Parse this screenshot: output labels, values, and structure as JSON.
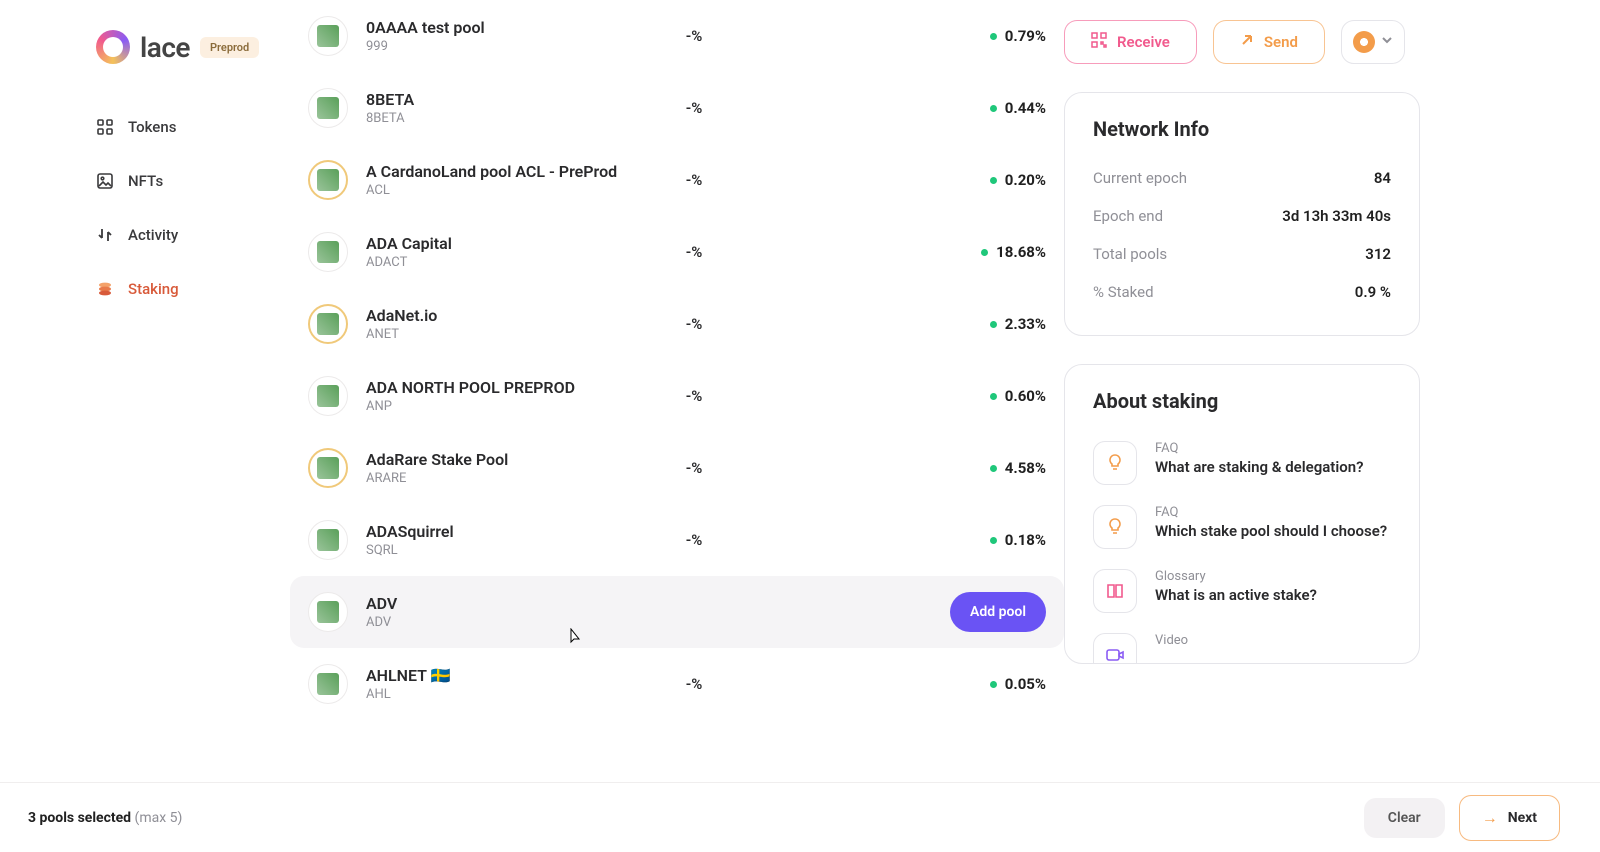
{
  "brand": {
    "name": "lace",
    "env": "Preprod"
  },
  "sidebar": {
    "items": [
      {
        "label": "Tokens"
      },
      {
        "label": "NFTs"
      },
      {
        "label": "Activity"
      },
      {
        "label": "Staking"
      }
    ]
  },
  "topbar": {
    "receive": "Receive",
    "send": "Send"
  },
  "pools": [
    {
      "name": "0AAAA test pool",
      "ticker": "999",
      "col": "-%",
      "ros": "0.79%",
      "ringed": false
    },
    {
      "name": "8BETA",
      "ticker": "8BETA",
      "col": "-%",
      "ros": "0.44%",
      "ringed": false
    },
    {
      "name": "A CardanoLand pool ACL - PreProd",
      "ticker": "ACL",
      "col": "-%",
      "ros": "0.20%",
      "ringed": true
    },
    {
      "name": "ADA Capital",
      "ticker": "ADACT",
      "col": "-%",
      "ros": "18.68%",
      "ringed": false
    },
    {
      "name": "AdaNet.io",
      "ticker": "ANET",
      "col": "-%",
      "ros": "2.33%",
      "ringed": true
    },
    {
      "name": "ADA NORTH POOL PREPROD",
      "ticker": "ANP",
      "col": "-%",
      "ros": "0.60%",
      "ringed": false
    },
    {
      "name": "AdaRare Stake Pool",
      "ticker": "ARARE",
      "col": "-%",
      "ros": "4.58%",
      "ringed": true
    },
    {
      "name": "ADASquirrel",
      "ticker": "SQRL",
      "col": "-%",
      "ros": "0.18%",
      "ringed": false
    },
    {
      "name": "ADV",
      "ticker": "ADV",
      "hovered": true,
      "ringed": false
    },
    {
      "name": "AHLNET 🇸🇪",
      "ticker": "AHL",
      "col": "-%",
      "ros": "0.05%",
      "ringed": false
    }
  ],
  "addPoolLabel": "Add pool",
  "networkInfo": {
    "title": "Network Info",
    "rows": [
      {
        "label": "Current epoch",
        "value": "84"
      },
      {
        "label": "Epoch end",
        "value": "3d 13h 33m 40s"
      },
      {
        "label": "Total pools",
        "value": "312"
      },
      {
        "label": "% Staked",
        "value": "0.9 %"
      }
    ]
  },
  "about": {
    "title": "About staking",
    "items": [
      {
        "cat": "FAQ",
        "title": "What are staking & delegation?",
        "icon": "bulb"
      },
      {
        "cat": "FAQ",
        "title": "Which stake pool should I choose?",
        "icon": "bulb"
      },
      {
        "cat": "Glossary",
        "title": "What is an active stake?",
        "icon": "book"
      },
      {
        "cat": "Video",
        "title": "",
        "icon": "video"
      }
    ]
  },
  "footer": {
    "selected": "3 pools selected",
    "max": " (max 5)",
    "clear": "Clear",
    "next": "Next"
  }
}
